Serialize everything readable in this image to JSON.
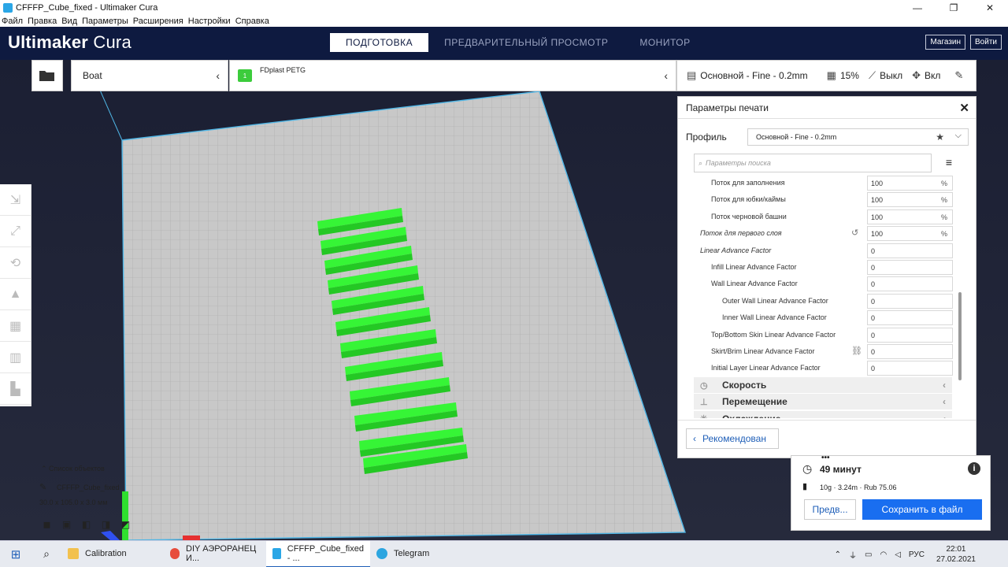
{
  "window": {
    "title": "CFFFP_Cube_fixed - Ultimaker Cura",
    "min": "—",
    "max": "❐",
    "close": "✕"
  },
  "menu": [
    "Файл",
    "Правка",
    "Вид",
    "Параметры",
    "Расширения",
    "Настройки",
    "Справка"
  ],
  "header": {
    "logo_main": "Ultimaker",
    "logo_sub": "Cura",
    "tabs": [
      {
        "label": "ПОДГОТОВКА",
        "active": true
      },
      {
        "label": "ПРЕДВАРИТЕЛЬНЫЙ ПРОСМОТР",
        "active": false
      },
      {
        "label": "МОНИТОР",
        "active": false
      }
    ],
    "marketplace": "Магазин",
    "signin": "Войти"
  },
  "toolbar": {
    "machine": "Boat",
    "material_badge": "1",
    "material": "FDplast PETG",
    "profile": "Основной - Fine - 0.2mm",
    "infill": "15%",
    "support": "Выкл",
    "adhesion": "Вкл"
  },
  "panel": {
    "title": "Параметры печати",
    "profile_label": "Профиль",
    "profile_value": "Основной - Fine - 0.2mm",
    "search_placeholder": "Параметры поиска",
    "settings": [
      {
        "label": "Поток для заполнения",
        "value": "100",
        "unit": "%",
        "indent": 2
      },
      {
        "label": "Поток для юбки/каймы",
        "value": "100",
        "unit": "%",
        "indent": 2
      },
      {
        "label": "Поток черновой башни",
        "value": "100",
        "unit": "%",
        "indent": 2
      },
      {
        "label": "Поток для первого слоя",
        "value": "100",
        "unit": "%",
        "indent": 1
      },
      {
        "label": "Linear Advance Factor",
        "value": "0",
        "unit": "",
        "indent": 1
      },
      {
        "label": "Infill Linear Advance Factor",
        "value": "0",
        "unit": "",
        "indent": 2
      },
      {
        "label": "Wall Linear Advance Factor",
        "value": "0",
        "unit": "",
        "indent": 2
      },
      {
        "label": "Outer Wall Linear Advance Factor",
        "value": "0",
        "unit": "",
        "indent": 3
      },
      {
        "label": "Inner Wall Linear Advance Factor",
        "value": "0",
        "unit": "",
        "indent": 3
      },
      {
        "label": "Top/Bottom Skin Linear Advance Factor",
        "value": "0",
        "unit": "",
        "indent": 2
      },
      {
        "label": "Skirt/Brim Linear Advance Factor",
        "value": "0",
        "unit": "",
        "indent": 2
      },
      {
        "label": "Initial Layer Linear Advance Factor",
        "value": "0",
        "unit": "",
        "indent": 2
      }
    ],
    "categories": [
      "Скорость",
      "Перемещение",
      "Охлаждение"
    ],
    "recommended": "Рекомендован"
  },
  "objects": {
    "header": "Список объектов",
    "name": "CFFFP_Cube_fixed",
    "dims": "30.0 x 105.0 x 3.0 мм"
  },
  "job": {
    "time": "49 минут",
    "material": "10g · 3.24m · Rub 75.06",
    "preview": "Предв...",
    "save": "Сохранить в файл"
  },
  "taskbar": {
    "apps": [
      {
        "label": "Calibration",
        "color": "#f2c14e",
        "active": false
      },
      {
        "label": "DIY АЭРОРАНЕЦ И...",
        "color": "#e74c3c",
        "active": false
      },
      {
        "label": "CFFFP_Cube_fixed - ...",
        "color": "#2aa6e6",
        "active": true
      },
      {
        "label": "Telegram",
        "color": "#2ca5e0",
        "active": false
      }
    ],
    "lang": "РУС",
    "time": "22:01",
    "date": "27.02.2021"
  },
  "colors": {
    "header_bg": "#0e1a40",
    "accent": "#196ef0",
    "model": "#3cf03c",
    "bed": "#c8c8c8"
  }
}
